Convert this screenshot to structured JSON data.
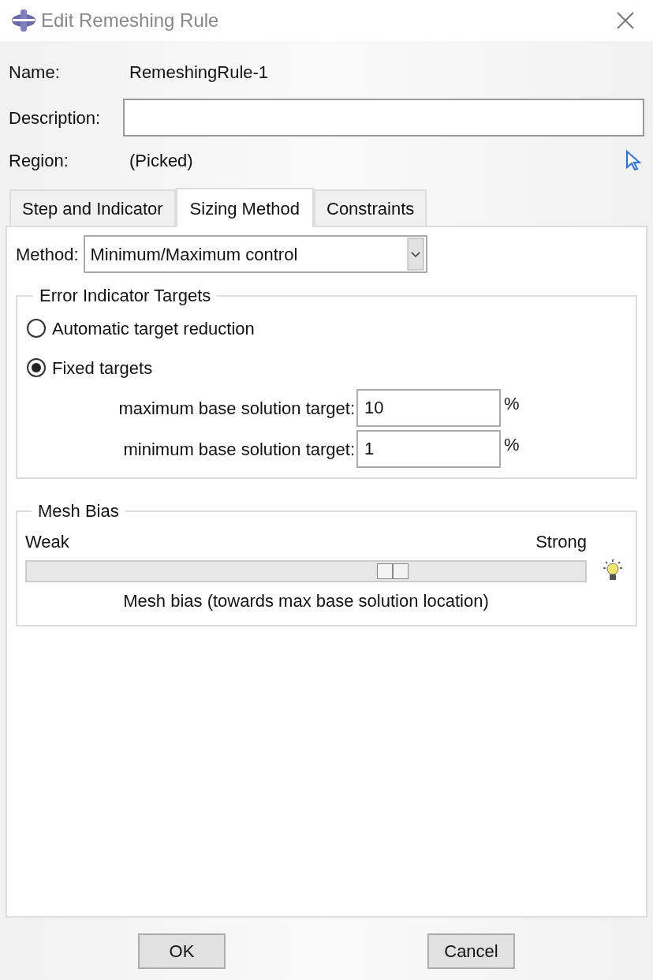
{
  "window": {
    "title": "Edit Remeshing Rule"
  },
  "name": {
    "label": "Name:",
    "value": "RemeshingRule-1"
  },
  "description": {
    "label": "Description:"
  },
  "region": {
    "label": "Region:",
    "value": "(Picked)"
  },
  "tabs": [
    {
      "label": "Step and Indicator",
      "selected": false
    },
    {
      "label": "Sizing Method",
      "selected": true
    },
    {
      "label": "Constraints",
      "selected": false
    }
  ],
  "method": {
    "label": "Method:",
    "value": "Minimum/Maximum control"
  },
  "error_indicator_targets": {
    "title": "Error Indicator Targets",
    "options": [
      {
        "label": "Automatic target reduction",
        "selected": false
      },
      {
        "label": "Fixed targets",
        "selected": true
      }
    ],
    "fields": [
      {
        "label": "maximum base solution target:",
        "value": "10",
        "unit": "%"
      },
      {
        "label": "minimum base solution target:",
        "value": "1",
        "unit": "%"
      }
    ]
  },
  "mesh_bias": {
    "title": "Mesh Bias",
    "min_label": "Weak",
    "max_label": "Strong",
    "level": 0.655,
    "caption": "Mesh bias (towards max base solution location)"
  },
  "buttons": [
    "OK",
    "Cancel"
  ]
}
